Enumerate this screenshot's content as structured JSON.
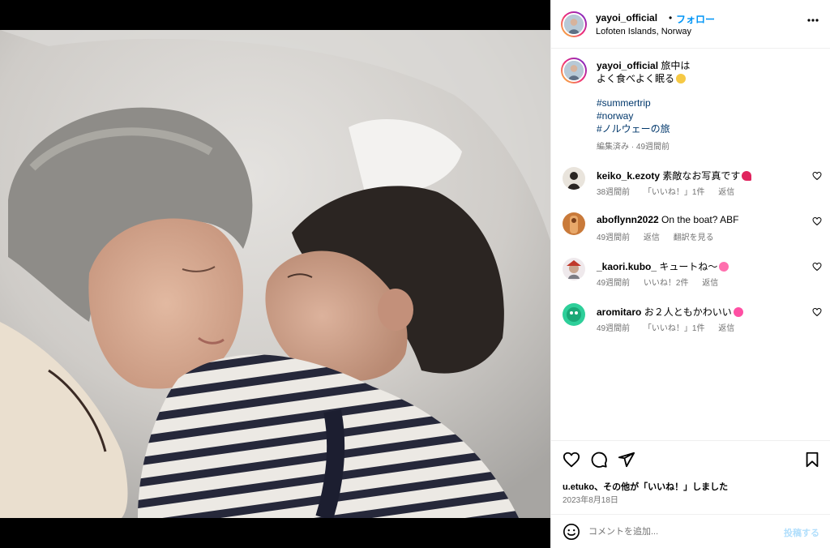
{
  "post": {
    "username": "yayoi_official",
    "follow_label": "フォロー",
    "separator": "•",
    "location": "Lofoten Islands, Norway",
    "caption_line1": "旅中は",
    "caption_line2": "よく食べよく眠る",
    "hashtags": [
      "#summertrip",
      "#norway",
      "#ノルウェーの旅"
    ],
    "caption_meta": "編集済み · 49週間前"
  },
  "comments": [
    {
      "user": "keiko_k.ezoty",
      "text": "素敵なお写真です",
      "emoji": "heart-exclamation-icon",
      "time": "38週間前",
      "likes": "「いいね！」1件",
      "reply": "返信",
      "extra": "",
      "avatar_color": "#e9e4dc"
    },
    {
      "user": "aboflynn2022",
      "text": "On the boat? ABF",
      "emoji": "",
      "time": "49週間前",
      "likes": "",
      "reply": "返信",
      "extra": "翻訳を見る",
      "avatar_color": "#c97a3a"
    },
    {
      "user": "_kaori.kubo_",
      "text": "キュートね〜",
      "emoji": "two-hearts-icon",
      "time": "49週間前",
      "likes": "いいね！2件",
      "reply": "返信",
      "extra": "",
      "avatar_color": "#d9c7d0"
    },
    {
      "user": "aromitaro",
      "text": "お２人ともかわいい",
      "emoji": "pink-heart-icon",
      "time": "49週間前",
      "likes": "「いいね！」1件",
      "reply": "返信",
      "extra": "",
      "avatar_color": "#2ecf9a"
    }
  ],
  "engagement": {
    "likes_text": "u.etuko、その他が「いいね！」しました",
    "date": "2023年8月18日"
  },
  "add_comment": {
    "placeholder": "コメントを追加...",
    "post_label": "投稿する"
  },
  "colors": {
    "link": "#0095f6",
    "hashtag": "#00376b",
    "muted": "#737373",
    "post_disabled": "#b2dffc"
  }
}
